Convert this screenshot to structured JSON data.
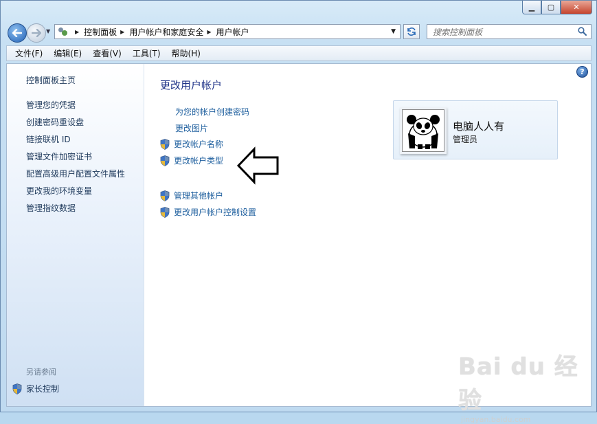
{
  "window": {
    "buttons": {
      "minimize": "▁",
      "maximize": "▢",
      "close": "✕"
    }
  },
  "address": {
    "crumbs": [
      "控制面板",
      "用户帐户和家庭安全",
      "用户帐户"
    ]
  },
  "search": {
    "placeholder": "搜索控制面板"
  },
  "menu": [
    "文件(F)",
    "编辑(E)",
    "查看(V)",
    "工具(T)",
    "帮助(H)"
  ],
  "sidebar": {
    "home": "控制面板主页",
    "links": [
      "管理您的凭据",
      "创建密码重设盘",
      "链接联机 ID",
      "管理文件加密证书",
      "配置高级用户配置文件属性",
      "更改我的环境变量",
      "管理指纹数据"
    ],
    "see_also": "另请参阅",
    "parental": "家长控制"
  },
  "main": {
    "title": "更改用户帐户",
    "tasks": [
      {
        "label": "为您的帐户创建密码",
        "shield": false
      },
      {
        "label": "更改图片",
        "shield": false
      },
      {
        "label": "更改帐户名称",
        "shield": true
      },
      {
        "label": "更改帐户类型",
        "shield": true
      }
    ],
    "tasks2": [
      {
        "label": "管理其他帐户",
        "shield": true
      },
      {
        "label": "更改用户帐户控制设置",
        "shield": true
      }
    ]
  },
  "user": {
    "name": "电脑人人有",
    "role": "管理员"
  },
  "watermark": {
    "brand": "Bai du 经验",
    "url": "jingyan.baidu.com"
  },
  "icons": {
    "back": "back-arrow-icon",
    "forward": "forward-arrow-icon",
    "refresh": "refresh-icon",
    "search": "search-icon",
    "help": "help-icon",
    "shield": "uac-shield-icon",
    "pointer": "outline-arrow-icon"
  }
}
